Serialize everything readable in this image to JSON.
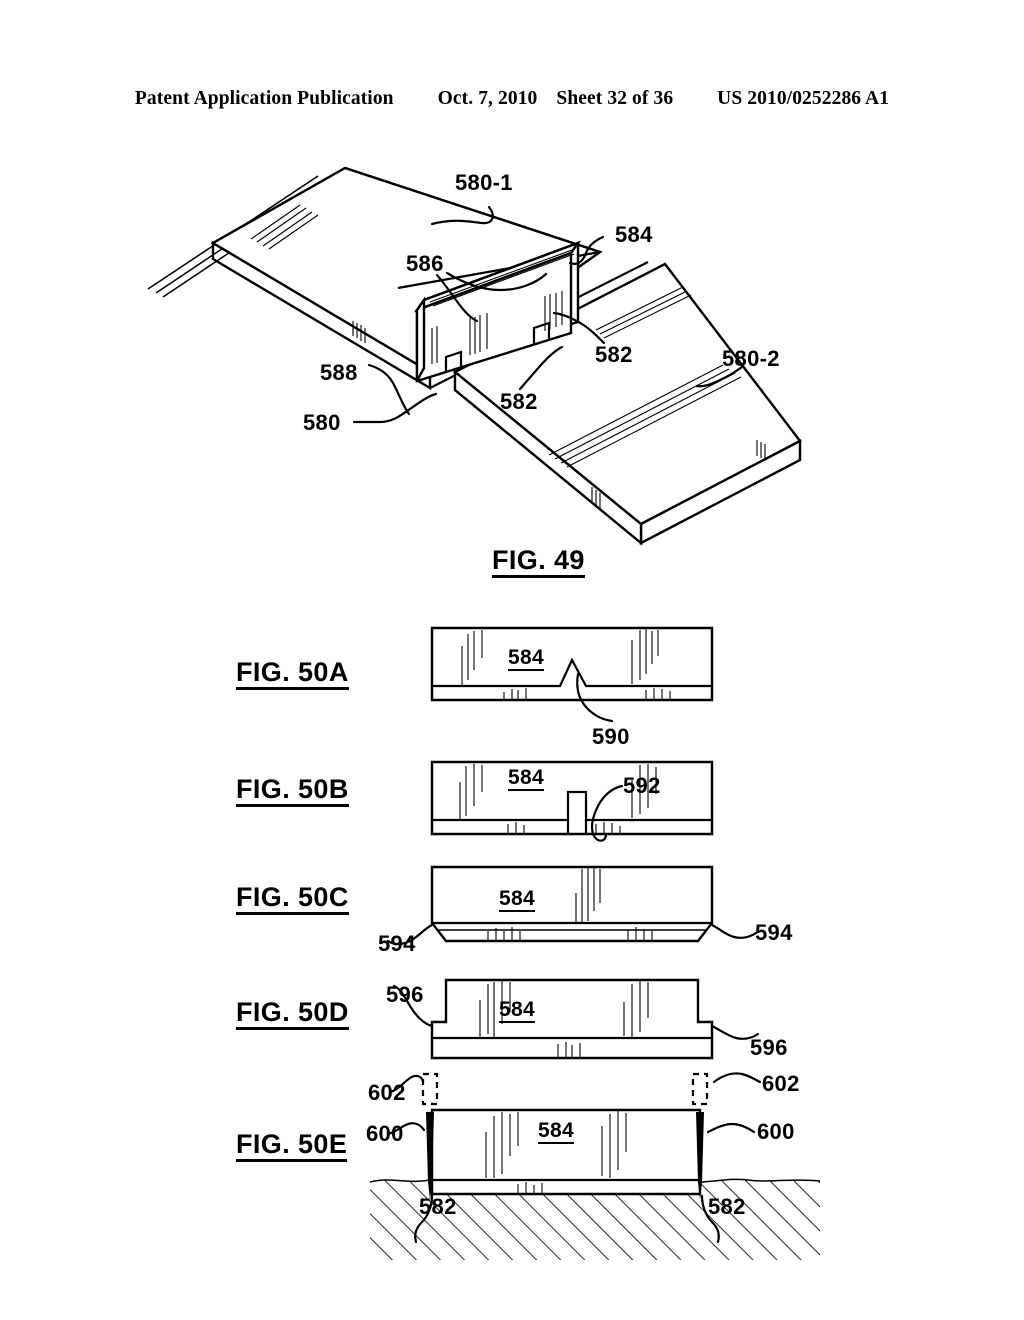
{
  "header": {
    "publication": "Patent Application Publication",
    "date": "Oct. 7, 2010",
    "sheet": "Sheet 32 of 36",
    "patent_number": "US 2010/0252286 A1"
  },
  "figures": [
    {
      "id": "fig49",
      "caption": "FIG. 49",
      "type": "isometric-perspective",
      "description": "Two coplanar panel substrates separated by a gap, with a thin vertical wall plate standing upright along the gap edge.",
      "labels": [
        {
          "text": "580-1",
          "role": "upper-left-panel"
        },
        {
          "text": "584",
          "role": "vertical-wall-plate"
        },
        {
          "text": "586",
          "role": "wall-inner-face"
        },
        {
          "text": "582",
          "role": "gap-slot-right"
        },
        {
          "text": "582",
          "role": "gap-slot-left"
        },
        {
          "text": "580-2",
          "role": "lower-right-panel"
        },
        {
          "text": "588",
          "role": "panel-edge-feature"
        },
        {
          "text": "580",
          "role": "panel-assembly"
        }
      ]
    },
    {
      "id": "fig50a",
      "caption": "FIG. 50A",
      "type": "cross-section",
      "body_label": "584",
      "feature_label": "590",
      "feature": "triangular-peak-protrusion"
    },
    {
      "id": "fig50b",
      "caption": "FIG. 50B",
      "type": "cross-section",
      "body_label": "584",
      "feature_label": "592",
      "feature": "rectangular-tab-protrusion"
    },
    {
      "id": "fig50c",
      "caption": "FIG. 50C",
      "type": "cross-section",
      "body_label": "584",
      "feature_labels": [
        "594",
        "594"
      ],
      "feature": "chamfered-bottom-corners"
    },
    {
      "id": "fig50d",
      "caption": "FIG. 50D",
      "type": "cross-section",
      "body_label": "584",
      "feature_labels": [
        "596",
        "596"
      ],
      "feature": "stepped-shoulder-corners"
    },
    {
      "id": "fig50e",
      "caption": "FIG. 50E",
      "type": "cross-section-in-substrate",
      "body_label": "584",
      "feature_labels": [
        "602",
        "602",
        "600",
        "600",
        "582",
        "582"
      ],
      "feature": "wall-inserted-into-hatched-substrate-with-insertion-arrows"
    }
  ]
}
